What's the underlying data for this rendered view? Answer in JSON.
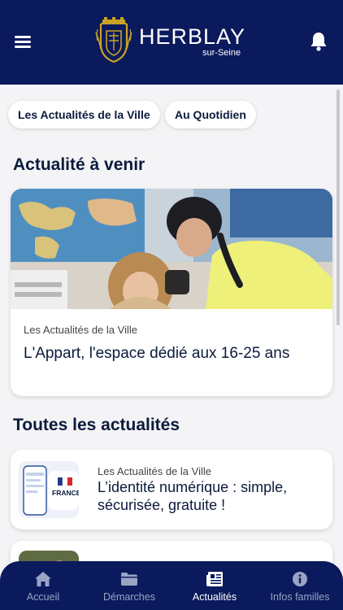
{
  "header": {
    "brand_name": "HERBLAY",
    "brand_sub": "sur-Seine"
  },
  "icons": {
    "menu": "hamburger-menu-icon",
    "notifications": "bell-icon",
    "crest": "city-crest-logo"
  },
  "chips": [
    {
      "label": "Les Actualités de la Ville"
    },
    {
      "label": "Au Quotidien"
    }
  ],
  "upcoming": {
    "title": "Actualité à venir",
    "card": {
      "category": "Les Actualités de la Ville",
      "title": "L'Appart, l'espace dédié aux 16-25 ans"
    }
  },
  "all_news": {
    "title": "Toutes les actualités",
    "items": [
      {
        "category": "Les Actualités de la Ville",
        "title": "L’identité numérique : simple, sécurisée, gratuite !",
        "thumb_text": "FRANCE IDENTITÉ"
      }
    ]
  },
  "tabbar": {
    "tabs": [
      {
        "label": "Accueil",
        "icon": "home-icon",
        "active": false
      },
      {
        "label": "Démarches",
        "icon": "folder-icon",
        "active": false
      },
      {
        "label": "Actualités",
        "icon": "newspaper-icon",
        "active": true
      },
      {
        "label": "Infos familles",
        "icon": "info-icon",
        "active": false
      }
    ]
  },
  "colors": {
    "primary": "#0b1a5c",
    "background": "#f4f4f6",
    "card": "#ffffff",
    "text_dark": "#0b1a3c",
    "crest_gold": "#c9a227"
  }
}
